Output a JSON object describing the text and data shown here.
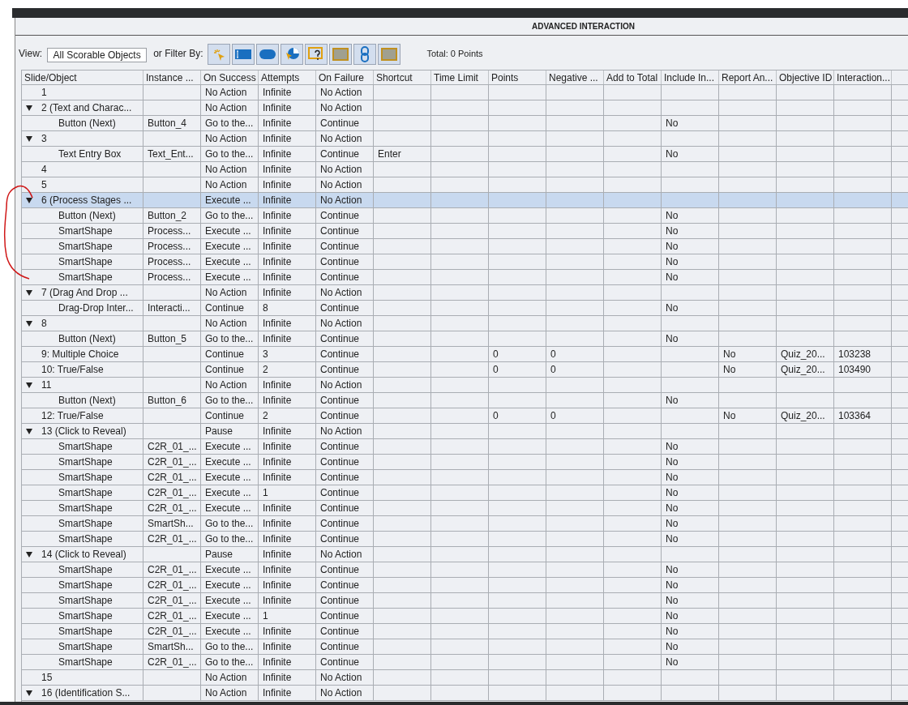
{
  "panel": {
    "title": "ADVANCED INTERACTION"
  },
  "toolbar": {
    "view_label": "View:",
    "view_value": "All Scorable Objects",
    "filter_label": "or Filter By:",
    "total": "Total: 0 Points"
  },
  "filters": [
    {
      "kind": "click"
    },
    {
      "kind": "text"
    },
    {
      "kind": "button"
    },
    {
      "kind": "rollover"
    },
    {
      "kind": "question"
    },
    {
      "kind": "box"
    },
    {
      "kind": "link"
    },
    {
      "kind": "box"
    }
  ],
  "columns": [
    "Slide/Object",
    "Instance ...",
    "On Success",
    "Attempts",
    "On Failure",
    "Shortcut",
    "Time Limit",
    "Points",
    "Negative ...",
    "Add to Total",
    "Include In...",
    "Report An...",
    "Objective ID",
    "Interaction..."
  ],
  "rows": [
    {
      "name": "1",
      "on_success": "No Action",
      "attempts": "Infinite",
      "on_failure": "No Action",
      "selected": false
    },
    {
      "name": "2 (Text and Charac...",
      "on_success": "No Action",
      "attempts": "Infinite",
      "on_failure": "No Action",
      "selected": false,
      "expanded": true,
      "children": [
        {
          "name": "Button (Next)",
          "instance": "Button_4",
          "on_success": "Go to the...",
          "attempts": "Infinite",
          "on_failure": "Continue",
          "include_in": "No",
          "selected": false
        }
      ]
    },
    {
      "name": "3",
      "on_success": "No Action",
      "attempts": "Infinite",
      "on_failure": "No Action",
      "selected": false,
      "expanded": true,
      "children": [
        {
          "name": "Text Entry Box",
          "instance": "Text_Ent...",
          "on_success": "Go to the...",
          "attempts": "Infinite",
          "on_failure": "Continue",
          "shortcut": "Enter",
          "include_in": "No",
          "selected": false
        }
      ]
    },
    {
      "name": "4",
      "on_success": "No Action",
      "attempts": "Infinite",
      "on_failure": "No Action",
      "selected": false
    },
    {
      "name": "5",
      "on_success": "No Action",
      "attempts": "Infinite",
      "on_failure": "No Action",
      "selected": false
    },
    {
      "name": "6 (Process Stages ...",
      "on_success": "Execute ...",
      "attempts": "Infinite",
      "on_failure": "No Action",
      "selected": true,
      "expanded": true,
      "children": [
        {
          "name": "Button (Next)",
          "instance": "Button_2",
          "on_success": "Go to the...",
          "attempts": "Infinite",
          "on_failure": "Continue",
          "include_in": "No",
          "selected": false
        },
        {
          "name": "SmartShape",
          "instance": "Process...",
          "on_success": "Execute ...",
          "attempts": "Infinite",
          "on_failure": "Continue",
          "include_in": "No",
          "selected": false
        },
        {
          "name": "SmartShape",
          "instance": "Process...",
          "on_success": "Execute ...",
          "attempts": "Infinite",
          "on_failure": "Continue",
          "include_in": "No",
          "selected": false
        },
        {
          "name": "SmartShape",
          "instance": "Process...",
          "on_success": "Execute ...",
          "attempts": "Infinite",
          "on_failure": "Continue",
          "include_in": "No",
          "selected": false
        },
        {
          "name": "SmartShape",
          "instance": "Process...",
          "on_success": "Execute ...",
          "attempts": "Infinite",
          "on_failure": "Continue",
          "include_in": "No",
          "selected": false
        }
      ]
    },
    {
      "name": "7 (Drag And Drop ...",
      "on_success": "No Action",
      "attempts": "Infinite",
      "on_failure": "No Action",
      "selected": false,
      "expanded": true,
      "children": [
        {
          "name": "Drag-Drop Inter...",
          "instance": "Interacti...",
          "on_success": "Continue",
          "attempts": "8",
          "on_failure": "Continue",
          "include_in": "No",
          "selected": false
        }
      ]
    },
    {
      "name": "8",
      "on_success": "No Action",
      "attempts": "Infinite",
      "on_failure": "No Action",
      "selected": false,
      "expanded": true,
      "children": [
        {
          "name": "Button (Next)",
          "instance": "Button_5",
          "on_success": "Go to the...",
          "attempts": "Infinite",
          "on_failure": "Continue",
          "include_in": "No",
          "selected": false
        }
      ]
    },
    {
      "name": "9: Multiple Choice",
      "on_success": "Continue",
      "attempts": "3",
      "on_failure": "Continue",
      "points": "0",
      "negative": "0",
      "report_an": "No",
      "objective_id": "Quiz_20...",
      "interaction": "103238",
      "selected": false
    },
    {
      "name": "10: True/False",
      "on_success": "Continue",
      "attempts": "2",
      "on_failure": "Continue",
      "points": "0",
      "negative": "0",
      "report_an": "No",
      "objective_id": "Quiz_20...",
      "interaction": "103490",
      "selected": false
    },
    {
      "name": "11",
      "on_success": "No Action",
      "attempts": "Infinite",
      "on_failure": "No Action",
      "selected": false,
      "expanded": true,
      "children": [
        {
          "name": "Button (Next)",
          "instance": "Button_6",
          "on_success": "Go to the...",
          "attempts": "Infinite",
          "on_failure": "Continue",
          "include_in": "No",
          "selected": false
        }
      ]
    },
    {
      "name": "12: True/False",
      "on_success": "Continue",
      "attempts": "2",
      "on_failure": "Continue",
      "points": "0",
      "negative": "0",
      "report_an": "No",
      "objective_id": "Quiz_20...",
      "interaction": "103364",
      "selected": false
    },
    {
      "name": "13 (Click to Reveal)",
      "on_success": "Pause",
      "attempts": "Infinite",
      "on_failure": "No Action",
      "selected": false,
      "expanded": true,
      "children": [
        {
          "name": "SmartShape",
          "instance": "C2R_01_...",
          "on_success": "Execute ...",
          "attempts": "Infinite",
          "on_failure": "Continue",
          "include_in": "No",
          "selected": false
        },
        {
          "name": "SmartShape",
          "instance": "C2R_01_...",
          "on_success": "Execute ...",
          "attempts": "Infinite",
          "on_failure": "Continue",
          "include_in": "No",
          "selected": false
        },
        {
          "name": "SmartShape",
          "instance": "C2R_01_...",
          "on_success": "Execute ...",
          "attempts": "Infinite",
          "on_failure": "Continue",
          "include_in": "No",
          "selected": false
        },
        {
          "name": "SmartShape",
          "instance": "C2R_01_...",
          "on_success": "Execute ...",
          "attempts": "1",
          "on_failure": "Continue",
          "include_in": "No",
          "selected": false
        },
        {
          "name": "SmartShape",
          "instance": "C2R_01_...",
          "on_success": "Execute ...",
          "attempts": "Infinite",
          "on_failure": "Continue",
          "include_in": "No",
          "selected": false
        },
        {
          "name": "SmartShape",
          "instance": "SmartSh...",
          "on_success": "Go to the...",
          "attempts": "Infinite",
          "on_failure": "Continue",
          "include_in": "No",
          "selected": false
        },
        {
          "name": "SmartShape",
          "instance": "C2R_01_...",
          "on_success": "Go to the...",
          "attempts": "Infinite",
          "on_failure": "Continue",
          "include_in": "No",
          "selected": false
        }
      ]
    },
    {
      "name": "14 (Click to Reveal)",
      "on_success": "Pause",
      "attempts": "Infinite",
      "on_failure": "No Action",
      "selected": false,
      "expanded": true,
      "children": [
        {
          "name": "SmartShape",
          "instance": "C2R_01_...",
          "on_success": "Execute ...",
          "attempts": "Infinite",
          "on_failure": "Continue",
          "include_in": "No",
          "selected": false
        },
        {
          "name": "SmartShape",
          "instance": "C2R_01_...",
          "on_success": "Execute ...",
          "attempts": "Infinite",
          "on_failure": "Continue",
          "include_in": "No",
          "selected": false
        },
        {
          "name": "SmartShape",
          "instance": "C2R_01_...",
          "on_success": "Execute ...",
          "attempts": "Infinite",
          "on_failure": "Continue",
          "include_in": "No",
          "selected": false
        },
        {
          "name": "SmartShape",
          "instance": "C2R_01_...",
          "on_success": "Execute ...",
          "attempts": "1",
          "on_failure": "Continue",
          "include_in": "No",
          "selected": false
        },
        {
          "name": "SmartShape",
          "instance": "C2R_01_...",
          "on_success": "Execute ...",
          "attempts": "Infinite",
          "on_failure": "Continue",
          "include_in": "No",
          "selected": false
        },
        {
          "name": "SmartShape",
          "instance": "SmartSh...",
          "on_success": "Go to the...",
          "attempts": "Infinite",
          "on_failure": "Continue",
          "include_in": "No",
          "selected": false
        },
        {
          "name": "SmartShape",
          "instance": "C2R_01_...",
          "on_success": "Go to the...",
          "attempts": "Infinite",
          "on_failure": "Continue",
          "include_in": "No",
          "selected": false
        }
      ]
    },
    {
      "name": "15",
      "on_success": "No Action",
      "attempts": "Infinite",
      "on_failure": "No Action",
      "selected": false
    },
    {
      "name": "16 (Identification S...",
      "on_success": "No Action",
      "attempts": "Infinite",
      "on_failure": "No Action",
      "selected": false,
      "expanded": true
    }
  ]
}
